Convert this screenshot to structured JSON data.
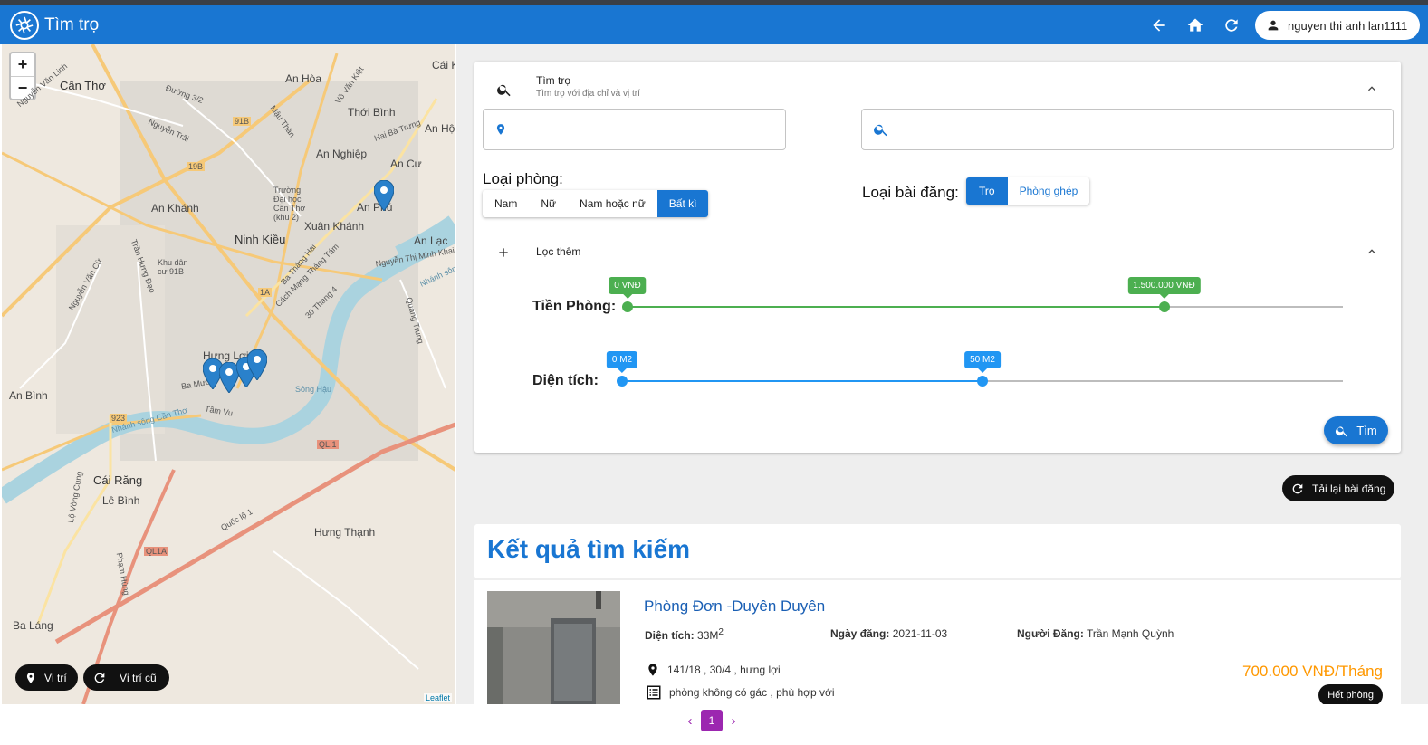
{
  "app": {
    "title": "Tìm trọ",
    "user_name": "nguyen thi anh lan1111"
  },
  "icons": {
    "back": "arrow-left-icon",
    "home": "home-icon",
    "refresh": "refresh-icon",
    "user": "person-icon",
    "logo": "aperture-logo-icon"
  },
  "map": {
    "zoom_in": "+",
    "zoom_out": "−",
    "labels": [
      "Cần Thơ",
      "Ninh Kiều",
      "An Khánh",
      "An Bình",
      "Cái Răng",
      "Lê Bình",
      "Hưng Thạnh",
      "Ba Láng",
      "An Hòa",
      "Thới Bình",
      "An Nghiệp",
      "Xuân Khánh",
      "An Cư",
      "An Lạc",
      "Hưng Lợi",
      "An Phú",
      "Cái Khế",
      "An Hội",
      "Trường Đại học Cần Thơ (khu 2)",
      "Khu dân cư 91B",
      "Sông Hậu"
    ],
    "road_labels": [
      "91B",
      "19B",
      "1A",
      "923",
      "QL.1",
      "QL1A",
      "Nguyễn Văn Cừ",
      "Trần Hưng Đạo",
      "Quốc lộ 1",
      "Ba Mươi",
      "Tầm Vu",
      "Nhánh sông Cần Thơ",
      "Cách Mạng Tháng Tám",
      "30 Tháng 4",
      "Đường 3/2",
      "Mậu Thân",
      "Quang Trung",
      "Võ Văn Kiệt",
      "Nguyễn Trãi",
      "Phạm Hùng",
      "Lộ Vòng Cung",
      "Nguyễn Thị Minh Khai",
      "Nguyễn Văn Linh",
      "Ba Tháng Hai",
      "Nhánh sông",
      "Hai Bà Trưng"
    ],
    "btn_location": "Vị trí",
    "btn_old_location": "Vị trí cũ",
    "attribution": "Leaflet",
    "marker_color": "#2a81cb"
  },
  "search": {
    "title": "Tìm trọ",
    "subtitle": "Tìm trọ với địa chỉ và vị trí",
    "location_value": "",
    "keyword_value": "",
    "room_type_label": "Loại phòng:",
    "room_types": [
      "Nam",
      "Nữ",
      "Nam hoặc nữ",
      "Bất kì"
    ],
    "room_type_selected": "Bất kì",
    "post_type_label": "Loại bài đăng:",
    "post_types": [
      "Trọ",
      "Phòng ghép"
    ],
    "post_type_selected": "Trọ",
    "more_filters": "Lọc thêm",
    "price_label": "Tiền Phòng:",
    "price_min_text": "0 VNĐ",
    "price_max_text": "1.500.000 VNĐ",
    "price_range_fraction": [
      0,
      0.75
    ],
    "area_label": "Diện tích:",
    "area_min_text": "0 M2",
    "area_max_text": "50 M2",
    "area_range_fraction": [
      0,
      0.5
    ],
    "price_color": "#4caf50",
    "area_color": "#2196f3",
    "search_button": "Tìm"
  },
  "reload_button": "Tải lại bài đăng",
  "results": {
    "title": "Kết quả tìm kiếm",
    "items": [
      {
        "title": "Phòng Đơn -Duyên Duyên",
        "area_label": "Diện tích:",
        "area_value": "33M",
        "area_sup": "2",
        "date_label": "Ngày đăng:",
        "date_value": "2021-11-03",
        "poster_label": "Người Đăng:",
        "poster_value": "Trần Mạnh Quỳnh",
        "address": "141/18 , 30/4 , hưng lợi",
        "description": "phòng không có gác , phù hợp với",
        "price": "700.000 VNĐ/Tháng",
        "status": "Hết phòng"
      }
    ]
  },
  "pagination": {
    "prev": "‹",
    "current": "1",
    "next": "›"
  },
  "colors": {
    "primary": "#1976d2",
    "accent_purple": "#9c27b0",
    "price_orange": "#ff9800"
  }
}
